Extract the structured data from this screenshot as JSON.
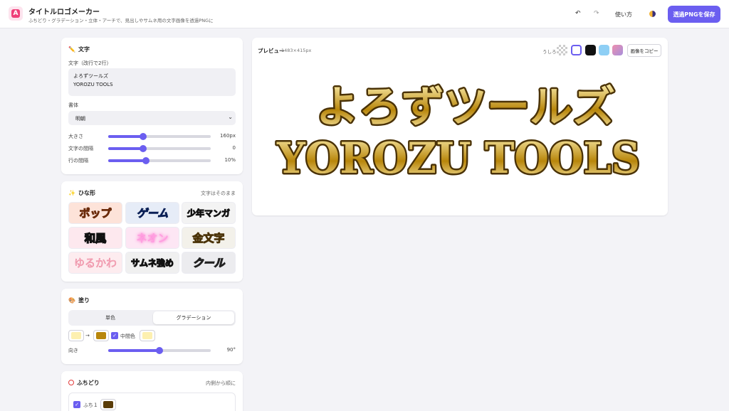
{
  "header": {
    "title": "タイトルロゴメーカー",
    "subtitle": "ふちどり・グラデーション・立体・アーチで、見出しやサムネ用の文字画像を透過PNGに",
    "undo_icon": "undo-icon",
    "redo_icon": "redo-icon",
    "help_label": "使い方",
    "theme_icon": "half-moon-icon",
    "save_label": "透過PNGを保存"
  },
  "text_panel": {
    "title": "文字",
    "text_label": "文字（改行で2行）",
    "text_value": "よろずツールズ\nYOROZU TOOLS",
    "font_label": "書体",
    "font_value": "明朝",
    "size_label": "大きさ",
    "size_value": "160px",
    "size_fraction": 0.34,
    "letter_label": "文字の間隔",
    "letter_value": "0",
    "letter_fraction": 0.34,
    "line_label": "行の間隔",
    "line_value": "10%",
    "line_fraction": 0.37
  },
  "preset_panel": {
    "title": "ひな形",
    "note": "文字はそのまま",
    "presets": [
      "ポップ",
      "ゲーム",
      "少年マンガ",
      "和風",
      "ネオン",
      "金文字",
      "ゆるかわ",
      "サムネ強め",
      "クール"
    ]
  },
  "fill_panel": {
    "title": "塗り",
    "mode_solid": "単色",
    "mode_gradient": "グラデーション",
    "arrow": "→",
    "middle_label": "中間色",
    "color_start": "#fdf0b0",
    "color_end": "#b8860b",
    "color_middle": "#fdf0b0",
    "direction_label": "向き",
    "direction_value": "90°",
    "direction_fraction": 0.5
  },
  "stroke_panel": {
    "title": "ふちどり",
    "note": "内側から順に",
    "stroke1_label": "ふち１",
    "stroke1_color": "#5a3c08"
  },
  "preview": {
    "title": "プレビュー",
    "size": "1483×415px",
    "bg_label": "うしろ",
    "copy_label": "画像をコピー",
    "line1": "よろずツールズ",
    "line2": "YOROZU TOOLS"
  },
  "colors": {
    "accent": "#6b5ef0",
    "gold_light": "#fdf0b0",
    "gold_dark": "#b8860b",
    "stroke_dark": "#5a3c08"
  }
}
